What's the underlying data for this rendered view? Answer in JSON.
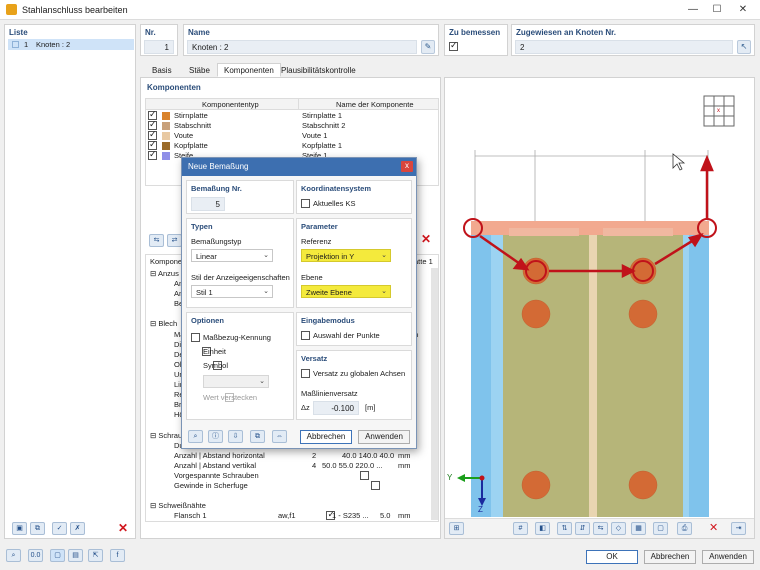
{
  "window": {
    "title": "Stahlanschluss bearbeiten"
  },
  "liste": {
    "label": "Liste",
    "items": [
      {
        "number": "1",
        "name": "Knoten : 2"
      }
    ]
  },
  "header": {
    "nr_label": "Nr.",
    "nr_value": "1",
    "name_label": "Name",
    "name_value": "Knoten : 2",
    "zu_bemessen_label": "Zu bemessen",
    "zugewiesen_label": "Zugewiesen an Knoten Nr.",
    "zugewiesen_value": "2"
  },
  "tabs": [
    "Basis",
    "Stäbe",
    "Komponenten",
    "Plausibilitätskontrolle"
  ],
  "komponenten": {
    "label": "Komponenten",
    "col_typ": "Komponententyp",
    "col_name": "Name der Komponente",
    "rows": [
      {
        "type": "Stirnplatte",
        "name": "Stirnplatte 1",
        "color": "#d9822b"
      },
      {
        "type": "Stabschnitt",
        "name": "Stabschnitt 2",
        "color": "#c8a07a"
      },
      {
        "type": "Voute",
        "name": "Voute 1",
        "color": "#e8c9a3"
      },
      {
        "type": "Kopfplatte",
        "name": "Kopfplatte 1",
        "color": "#9a6b2a"
      },
      {
        "type": "Steife",
        "name": "Steife 1",
        "color": "#8f8fe8"
      }
    ]
  },
  "props": {
    "komponente_label": "Kompone",
    "platte_label": "atte 1",
    "side_rows": [
      "Anzus",
      "An",
      "An",
      "Be"
    ],
    "blech_label": "Blech",
    "blech_rows": [
      "Ma",
      "Dic",
      "De",
      "Ob",
      "Un",
      "Lin",
      "Re",
      "Bre",
      "Hö"
    ],
    "blech_right": "h",
    "schrau_label": "Schrau",
    "schrau_rows": [
      {
        "name": "Du",
        "sym": "",
        "value": "",
        "unit": ""
      },
      {
        "name": "Anzahl | Abstand horizontal",
        "sym": "2",
        "value": "40.0 140.0 40.0",
        "unit": "mm"
      },
      {
        "name": "Anzahl | Abstand vertikal",
        "sym": "4",
        "value": "50.0 55.0 220.0 ...",
        "unit": "mm"
      },
      {
        "name": "Vorgespannte Schrauben",
        "sym": "",
        "value": "",
        "unit": ""
      },
      {
        "name": "Gewinde in Scherfuge",
        "sym": "",
        "value": "",
        "unit": ""
      }
    ],
    "schweiss_label": "Schweißnähte",
    "flansch_row": {
      "name": "Flansch 1",
      "sym": "aw,f1",
      "mat": "1 - S235 ...",
      "value": "5.0",
      "unit": "mm"
    }
  },
  "dialog": {
    "title": "Neue Bemaßung",
    "close": "x",
    "bemassung_nr_label": "Bemaßung Nr.",
    "bemassung_nr_value": "5",
    "koord_label": "Koordinatensystem",
    "aktuelles_ks": "Aktuelles KS",
    "typen_label": "Typen",
    "bemassungstyp_label": "Bemaßungstyp",
    "bemassungstyp_value": "Linear",
    "stil_label": "Stil der Anzeigeeigenschaften",
    "stil_value": "Stil 1",
    "parameter_label": "Parameter",
    "referenz_label": "Referenz",
    "referenz_value": "Projektion in Y",
    "ebene_label": "Ebene",
    "ebene_value": "Zweite Ebene",
    "optionen_label": "Optionen",
    "opt_massbezug": "Maßbezug-Kennung",
    "opt_einheit": "Einheit",
    "opt_symbol": "Symbol",
    "opt_wert": "Wert verstecken",
    "eingabemodus_label": "Eingabemodus",
    "auswahl_punkte": "Auswahl der Punkte",
    "versatz_label": "Versatz",
    "versatz_global": "Versatz zu globalen Achsen",
    "masslinienversatz_label": "Maßlinienversatz",
    "delta_z": "Δz",
    "versatz_value": "-0.100",
    "versatz_unit": "[m]",
    "abbrechen": "Abbrechen",
    "anwenden": "Anwenden"
  },
  "viewport": {
    "axis_y": "Y",
    "axis_z": "Z",
    "marker": "x"
  },
  "footer": {
    "ok": "OK",
    "abbrechen": "Abbrechen",
    "anwenden": "Anwenden"
  },
  "colors": {
    "accent": "#3d6fb0",
    "highlight": "#f4ea3c",
    "arrow": "#c0121a",
    "plate": "#a9b57a",
    "steel_blue": "#7fc3ec",
    "bolt": "#d36a35"
  }
}
